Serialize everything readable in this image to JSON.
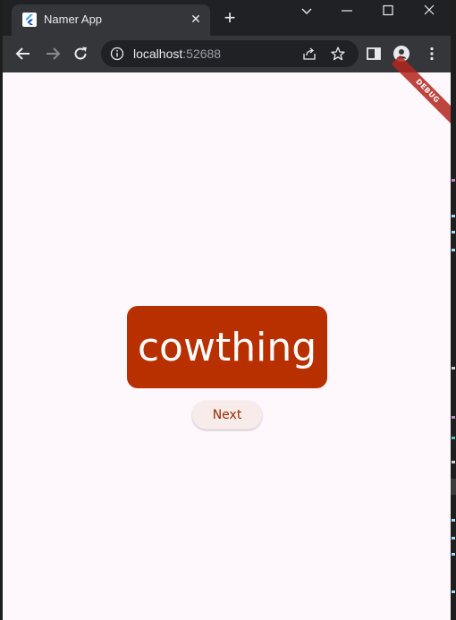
{
  "browser": {
    "tab_title": "Namer App",
    "tab_close_icon": "close-icon",
    "new_tab_label": "+",
    "url_host": "localhost",
    "url_port": ":52688"
  },
  "app": {
    "debug_banner": "DEBUG",
    "word": "cowthing",
    "next_label": "Next"
  },
  "colors": {
    "card": "#b83000",
    "background": "#fef7fc",
    "button_text": "#9a2a00"
  }
}
